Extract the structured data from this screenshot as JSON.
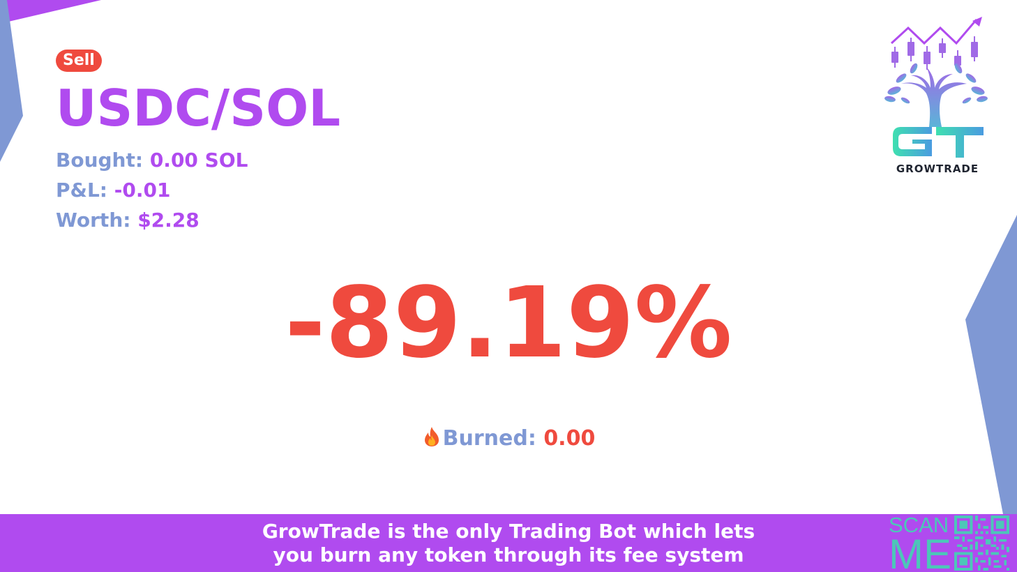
{
  "badge": {
    "label": "Sell",
    "color": "#ef4a3e"
  },
  "pair": {
    "name": "USDC/SOL",
    "color": "#b04bef"
  },
  "stats": {
    "bought_label": "Bought:",
    "bought_value": "0.00 SOL",
    "pnl_label": "P&L:",
    "pnl_value": "-0.01",
    "worth_label": "Worth:",
    "worth_value": "$2.28"
  },
  "percent_change": "-89.19%",
  "burned": {
    "icon": "fire-icon",
    "label": "Burned:",
    "value": "0.00"
  },
  "brand": {
    "name": "GROWTRADE",
    "monogram": "GT"
  },
  "footer": {
    "line1": "GrowTrade is the only Trading Bot which lets",
    "line2": "you burn any token through its fee system",
    "scan_line1": "SCAN",
    "scan_line2": "ME",
    "qr_icon": "qr-code-icon"
  },
  "colors": {
    "purple": "#b04bef",
    "periwinkle": "#7f98d4",
    "red": "#ef4a3e",
    "teal": "#4cc7b8"
  }
}
